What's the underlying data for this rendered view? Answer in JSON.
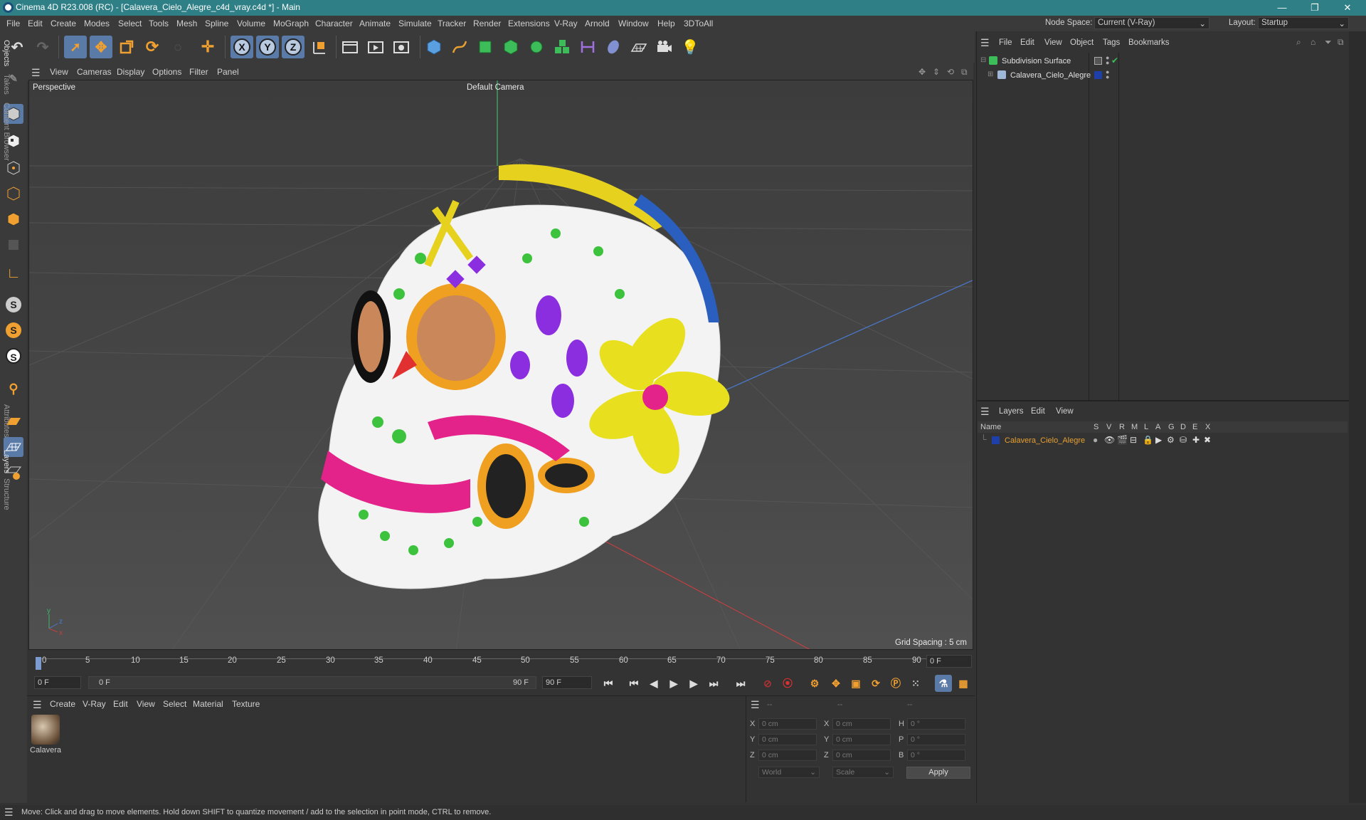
{
  "window": {
    "title": "Cinema 4D R23.008 (RC) - [Calavera_Cielo_Alegre_c4d_vray.c4d *] - Main",
    "minimize": "—",
    "maximize": "❐",
    "close": "✕"
  },
  "menubar": {
    "items": [
      "File",
      "Edit",
      "Create",
      "Modes",
      "Select",
      "Tools",
      "Mesh",
      "Spline",
      "Volume",
      "MoGraph",
      "Character",
      "Animate",
      "Simulate",
      "Tracker",
      "Render",
      "Extensions",
      "V-Ray",
      "Arnold",
      "Window",
      "Help",
      "3DToAll"
    ],
    "node_space_label": "Node Space:",
    "node_space_value": "Current (V-Ray)",
    "layout_label": "Layout:",
    "layout_value": "Startup"
  },
  "toolbar": {
    "axis_x": "X",
    "axis_y": "Y",
    "axis_z": "Z"
  },
  "viewport": {
    "menu": [
      "View",
      "Cameras",
      "Display",
      "Options",
      "Filter",
      "Panel"
    ],
    "view_name": "Perspective",
    "camera": "Default Camera",
    "grid_spacing": "Grid Spacing : 5 cm",
    "axis_y": "y",
    "axis_z": "z",
    "axis_x": "x"
  },
  "timeline": {
    "ticks": [
      "0",
      "5",
      "10",
      "15",
      "20",
      "25",
      "30",
      "35",
      "40",
      "45",
      "50",
      "55",
      "60",
      "65",
      "70",
      "75",
      "80",
      "85",
      "90"
    ],
    "current_frame": "0 F",
    "start_frame": "0 F",
    "range_start": "0 F",
    "range_end": "90 F",
    "end_frame": "90 F"
  },
  "material_panel": {
    "menu": [
      "Create",
      "V-Ray",
      "Edit",
      "View",
      "Select",
      "Material",
      "Texture"
    ],
    "materials": [
      {
        "name": "Calavera"
      }
    ]
  },
  "coordinates": {
    "headers": [
      "--",
      "--",
      "--"
    ],
    "rows": [
      {
        "a": "X",
        "a_val": "0 cm",
        "b": "X",
        "b_val": "0 cm",
        "c": "H",
        "c_val": "0 °"
      },
      {
        "a": "Y",
        "a_val": "0 cm",
        "b": "Y",
        "b_val": "0 cm",
        "c": "P",
        "c_val": "0 °"
      },
      {
        "a": "Z",
        "a_val": "0 cm",
        "b": "Z",
        "b_val": "0 cm",
        "c": "B",
        "c_val": "0 °"
      }
    ],
    "space": "World",
    "mode": "Scale",
    "apply": "Apply"
  },
  "objects_panel": {
    "menu": [
      "File",
      "Edit",
      "View",
      "Object",
      "Tags",
      "Bookmarks"
    ],
    "items": [
      {
        "name": "Subdivision Surface"
      },
      {
        "name": "Calavera_Cielo_Alegre"
      }
    ]
  },
  "layers_panel": {
    "menu": [
      "Layers",
      "Edit",
      "View"
    ],
    "header_name": "Name",
    "columns": [
      "S",
      "V",
      "R",
      "M",
      "L",
      "A",
      "G",
      "D",
      "E",
      "X"
    ],
    "layers": [
      {
        "name": "Calavera_Cielo_Alegre",
        "color": "#1f3fa8"
      }
    ]
  },
  "side_tabs": [
    "Objects",
    "Takes",
    "Content Browser",
    "Attributes",
    "Layers",
    "Structure"
  ],
  "status": "Move: Click and drag to move elements. Hold down SHIFT to quantize movement / add to the selection in point mode, CTRL to remove.",
  "colors": {
    "accent": "#2e7f86",
    "selected": "#5a7aa8",
    "layer_name": "#e8a030"
  }
}
